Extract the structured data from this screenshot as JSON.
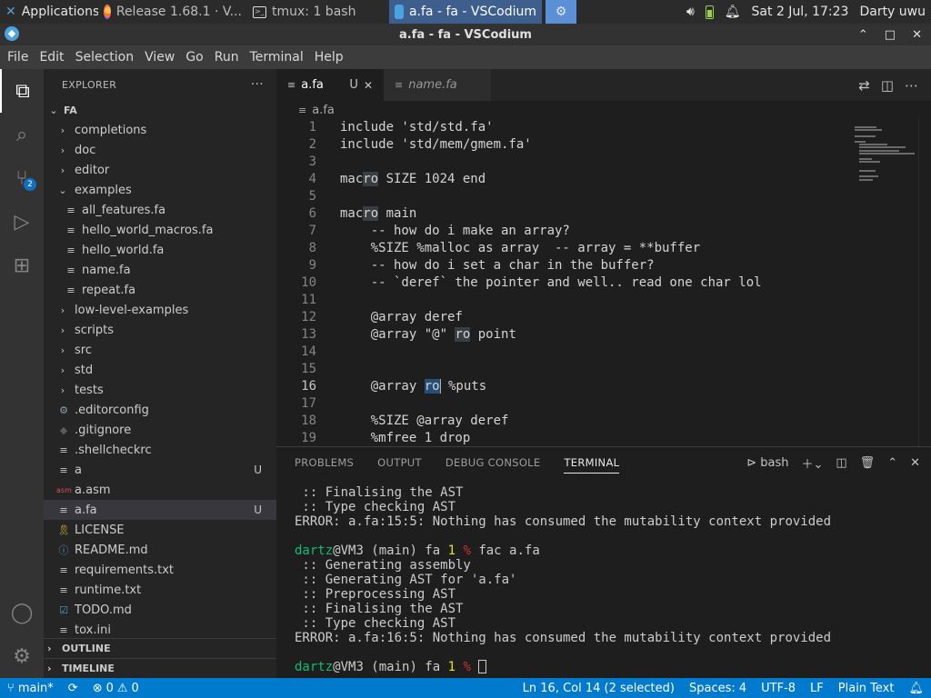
{
  "taskbar": {
    "apps_label": "Applications",
    "firefox_label": "Release 1.68.1 · V...",
    "tmux_label": "tmux: 1 bash",
    "vscode_label": "a.fa - fa - VSCodium",
    "datetime": "Sat  2 Jul, 17:23",
    "user": "Darty uwu"
  },
  "window": {
    "title": "a.fa - fa - VSCodium",
    "minimize": "⌃",
    "maximize": "□",
    "close": "✕"
  },
  "menu": [
    "File",
    "Edit",
    "Selection",
    "View",
    "Go",
    "Run",
    "Terminal",
    "Help"
  ],
  "activity": {
    "scm_badge": "2"
  },
  "explorer": {
    "header": "EXPLORER",
    "more": "···",
    "root": "FA",
    "items": [
      {
        "label": "completions",
        "kind": "folder",
        "expanded": false,
        "indent": 1
      },
      {
        "label": "doc",
        "kind": "folder",
        "expanded": false,
        "indent": 1
      },
      {
        "label": "editor",
        "kind": "folder",
        "expanded": false,
        "indent": 1
      },
      {
        "label": "examples",
        "kind": "folder",
        "expanded": true,
        "indent": 1
      },
      {
        "label": "all_features.fa",
        "kind": "file",
        "indent": 2
      },
      {
        "label": "hello_world_macros.fa",
        "kind": "file",
        "indent": 2
      },
      {
        "label": "hello_world.fa",
        "kind": "file",
        "indent": 2
      },
      {
        "label": "name.fa",
        "kind": "file",
        "indent": 2
      },
      {
        "label": "repeat.fa",
        "kind": "file",
        "indent": 2
      },
      {
        "label": "low-level-examples",
        "kind": "folder",
        "expanded": false,
        "indent": 1
      },
      {
        "label": "scripts",
        "kind": "folder",
        "expanded": false,
        "indent": 1
      },
      {
        "label": "src",
        "kind": "folder",
        "expanded": false,
        "indent": 1
      },
      {
        "label": "std",
        "kind": "folder",
        "expanded": false,
        "indent": 1
      },
      {
        "label": "tests",
        "kind": "folder",
        "expanded": false,
        "indent": 1
      },
      {
        "label": ".editorconfig",
        "kind": "gear",
        "indent": 1
      },
      {
        "label": ".gitignore",
        "kind": "dot",
        "indent": 1
      },
      {
        "label": ".shellcheckrc",
        "kind": "file",
        "indent": 1
      },
      {
        "label": "a",
        "kind": "file",
        "indent": 1,
        "status": "U"
      },
      {
        "label": "a.asm",
        "kind": "asm",
        "indent": 1
      },
      {
        "label": "a.fa",
        "kind": "file",
        "indent": 1,
        "status": "U",
        "selected": true
      },
      {
        "label": "LICENSE",
        "kind": "license",
        "indent": 1
      },
      {
        "label": "README.md",
        "kind": "info",
        "indent": 1
      },
      {
        "label": "requirements.txt",
        "kind": "file",
        "indent": 1
      },
      {
        "label": "runtime.txt",
        "kind": "file",
        "indent": 1
      },
      {
        "label": "TODO.md",
        "kind": "todo",
        "indent": 1
      },
      {
        "label": "tox.ini",
        "kind": "file",
        "indent": 1
      }
    ],
    "outline": "OUTLINE",
    "timeline": "TIMELINE"
  },
  "tabs": [
    {
      "label": "a.fa",
      "status": "U",
      "active": true
    },
    {
      "label": "name.fa",
      "active": false
    }
  ],
  "breadcrumb": "a.fa",
  "editor": {
    "current_line": 16,
    "lines": [
      {
        "n": "1",
        "text": "include 'std/std.fa'"
      },
      {
        "n": "2",
        "text": "include 'std/mem/gmem.fa'"
      },
      {
        "n": "3",
        "text": ""
      },
      {
        "n": "4",
        "pre": "mac",
        "mark": "ro",
        "post": " SIZE 1024 end"
      },
      {
        "n": "5",
        "text": ""
      },
      {
        "n": "6",
        "pre": "mac",
        "mark": "ro",
        "post": " main"
      },
      {
        "n": "7",
        "text": "    -- how do i make an array?"
      },
      {
        "n": "8",
        "text": "    %SIZE %malloc as array  -- array = **buffer"
      },
      {
        "n": "9",
        "text": "    -- how do i set a char in the buffer?"
      },
      {
        "n": "10",
        "text": "    -- `deref` the pointer and well.. read one char lol"
      },
      {
        "n": "11",
        "text": ""
      },
      {
        "n": "12",
        "text": "    @array deref"
      },
      {
        "n": "13",
        "pre": "    @array \"@\" ",
        "mark": "ro",
        "post": " point"
      },
      {
        "n": "14",
        "text": ""
      },
      {
        "n": "15",
        "text": ""
      },
      {
        "n": "16",
        "pre": "    @array ",
        "sel": "ro",
        "post": " %puts"
      },
      {
        "n": "17",
        "text": ""
      },
      {
        "n": "18",
        "text": "    %SIZE @array deref"
      },
      {
        "n": "19",
        "text": "    %mfree 1 drop"
      }
    ]
  },
  "panel": {
    "tabs": [
      "PROBLEMS",
      "OUTPUT",
      "DEBUG CONSOLE",
      "TERMINAL"
    ],
    "active_tab": "TERMINAL",
    "shell": "bash",
    "terminal": [
      {
        "text": " :: Finalising the AST"
      },
      {
        "text": " :: Type checking AST"
      },
      {
        "text": "ERROR: a.fa:15:5: Nothing has consumed the mutability context provided"
      },
      {
        "text": ""
      },
      {
        "prompt_user": "dartz",
        "prompt_host": "@VM3 (main) fa ",
        "prompt_num": "1",
        "prompt_pct": " %",
        "cmd": " fac a.fa"
      },
      {
        "text": " :: Generating assembly"
      },
      {
        "text": " :: Generating AST for 'a.fa'"
      },
      {
        "text": " :: Preprocessing AST"
      },
      {
        "text": " :: Finalising the AST"
      },
      {
        "text": " :: Type checking AST"
      },
      {
        "text": "ERROR: a.fa:16:5: Nothing has consumed the mutability context provided"
      },
      {
        "text": ""
      },
      {
        "prompt_user": "dartz",
        "prompt_host": "@VM3 (main) fa ",
        "prompt_num": "1",
        "prompt_pct": " %",
        "cmd": " ",
        "cursor": true
      }
    ]
  },
  "status": {
    "branch": "main*",
    "errors": "0",
    "warnings": "0",
    "position": "Ln 16, Col 14 (2 selected)",
    "spaces": "Spaces: 4",
    "encoding": "UTF-8",
    "eol": "LF",
    "language": "Plain Text"
  },
  "colors": {
    "statusbar": "#007acc",
    "accent": "#0e70c0",
    "selection": "#264f78"
  }
}
